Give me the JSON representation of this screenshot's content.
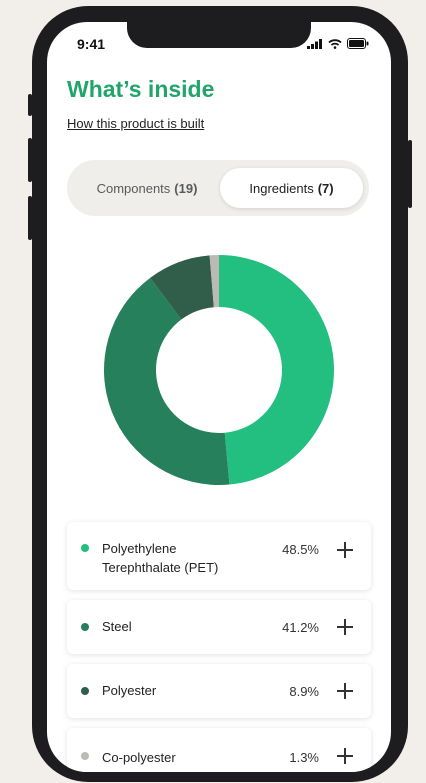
{
  "status_bar": {
    "time": "9:41"
  },
  "page": {
    "title": "What’s inside",
    "link": "How this product is built"
  },
  "tabs": [
    {
      "label": "Components",
      "count": "(19)",
      "active": false
    },
    {
      "label": "Ingredients",
      "count": "(7)",
      "active": true
    }
  ],
  "colors": {
    "accent": "#21a56a",
    "pet": "#22bf80",
    "steel": "#27805c",
    "polyester": "#315e4b",
    "co_polyester": "#bcbab5"
  },
  "chart_data": {
    "type": "pie",
    "donut": true,
    "categories": [
      "Polyethylene Terephthalate (PET)",
      "Steel",
      "Polyester",
      "Co-polyester"
    ],
    "values": [
      48.5,
      41.2,
      8.9,
      1.3
    ]
  },
  "ingredients": [
    {
      "name": "Polyethylene Terephthalate (PET)",
      "name_line1": "Polyethylene",
      "name_line2": "Terephthalate (PET)",
      "percent": "48.5%"
    },
    {
      "name": "Steel",
      "percent": "41.2%"
    },
    {
      "name": "Polyester",
      "percent": "8.9%"
    },
    {
      "name": "Co-polyester",
      "percent": "1.3%"
    }
  ]
}
